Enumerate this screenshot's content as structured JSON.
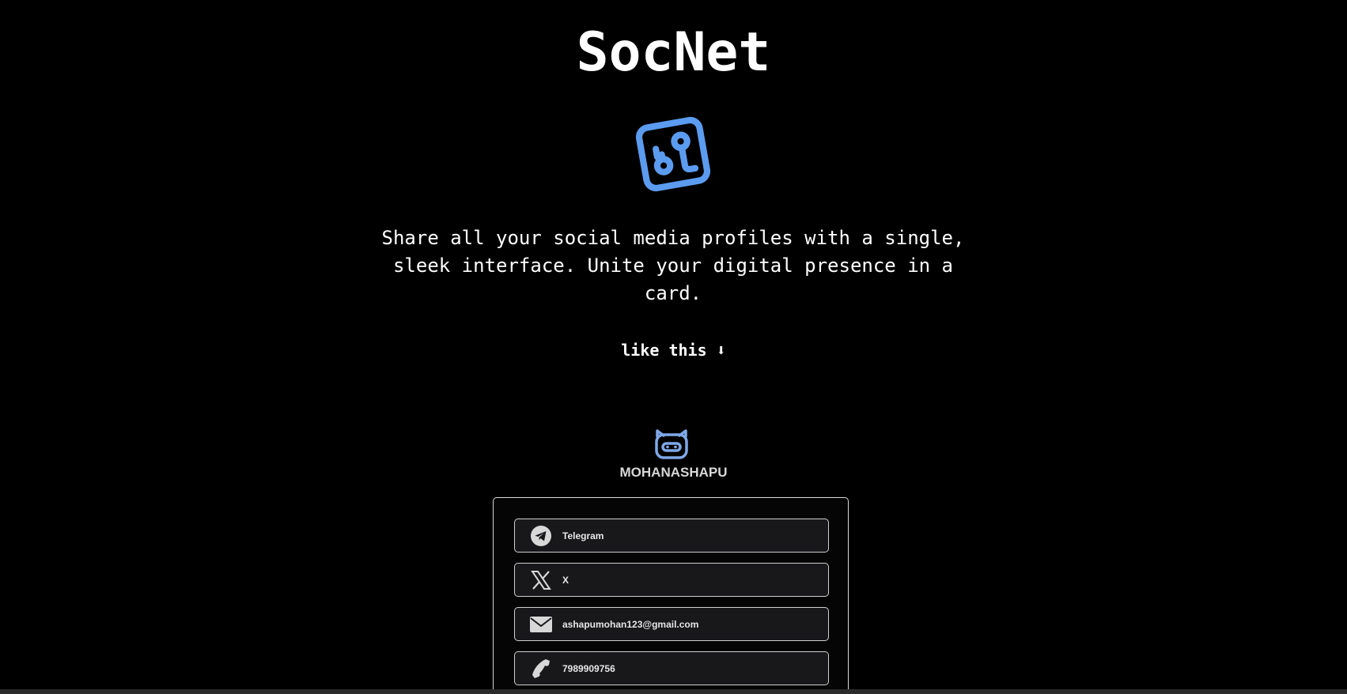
{
  "app": {
    "title": "SocNet",
    "tagline": "Share all your social media profiles with a single, sleek interface. Unite your digital presence in a card.",
    "example_hint": "like this ⬇"
  },
  "profile": {
    "username": "MOHANASHAPU",
    "avatar_icon": "robot-face-icon"
  },
  "colors": {
    "background": "#000000",
    "brand_blue": "#5b9cf0",
    "avatar_blue": "#7fa8e8",
    "link_bg": "#18181b",
    "border": "#d9d9d9"
  },
  "links": [
    {
      "label": "Telegram",
      "icon": "telegram-icon"
    },
    {
      "label": "X",
      "icon": "x-logo-icon"
    },
    {
      "label": "ashapumohan123@gmail.com",
      "icon": "envelope-icon"
    },
    {
      "label": "7989909756",
      "icon": "phone-icon"
    }
  ]
}
